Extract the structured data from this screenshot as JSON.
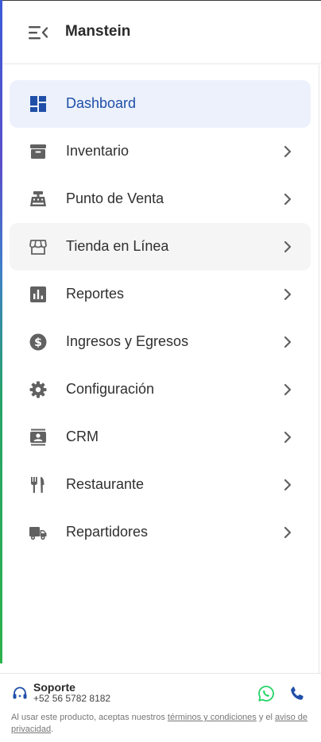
{
  "header": {
    "app_title": "Manstein",
    "menu_icon": "menu-collapse-icon"
  },
  "nav": {
    "items": [
      {
        "label": "Dashboard",
        "icon": "dashboard-icon",
        "active": true,
        "has_submenu": false
      },
      {
        "label": "Inventario",
        "icon": "archive-box-icon",
        "active": false,
        "has_submenu": true
      },
      {
        "label": "Punto de Venta",
        "icon": "cash-register-icon",
        "active": false,
        "has_submenu": true
      },
      {
        "label": "Tienda en Línea",
        "icon": "storefront-icon",
        "active": false,
        "has_submenu": true
      },
      {
        "label": "Reportes",
        "icon": "bar-chart-icon",
        "active": false,
        "has_submenu": true
      },
      {
        "label": "Ingresos y Egresos",
        "icon": "dollar-circle-icon",
        "active": false,
        "has_submenu": true
      },
      {
        "label": "Configuración",
        "icon": "gear-icon",
        "active": false,
        "has_submenu": true
      },
      {
        "label": "CRM",
        "icon": "contact-card-icon",
        "active": false,
        "has_submenu": true
      },
      {
        "label": "Restaurante",
        "icon": "fork-knife-icon",
        "active": false,
        "has_submenu": true
      },
      {
        "label": "Repartidores",
        "icon": "delivery-truck-icon",
        "active": false,
        "has_submenu": true
      }
    ]
  },
  "footer": {
    "support_title": "Soporte",
    "support_phone": "+52 56 5782 8182",
    "legal_prefix": "Al usar este producto, aceptas nuestros",
    "terms_link": "términos y condiciones",
    "legal_middle": "y el",
    "privacy_link": "aviso de privacidad",
    "legal_suffix": "."
  },
  "colors": {
    "accent": "#1f4fa8",
    "active_bg": "#ecf1fb",
    "hover_bg": "#f5f5f5",
    "whatsapp": "#25d366",
    "call": "#1f4fa8"
  }
}
